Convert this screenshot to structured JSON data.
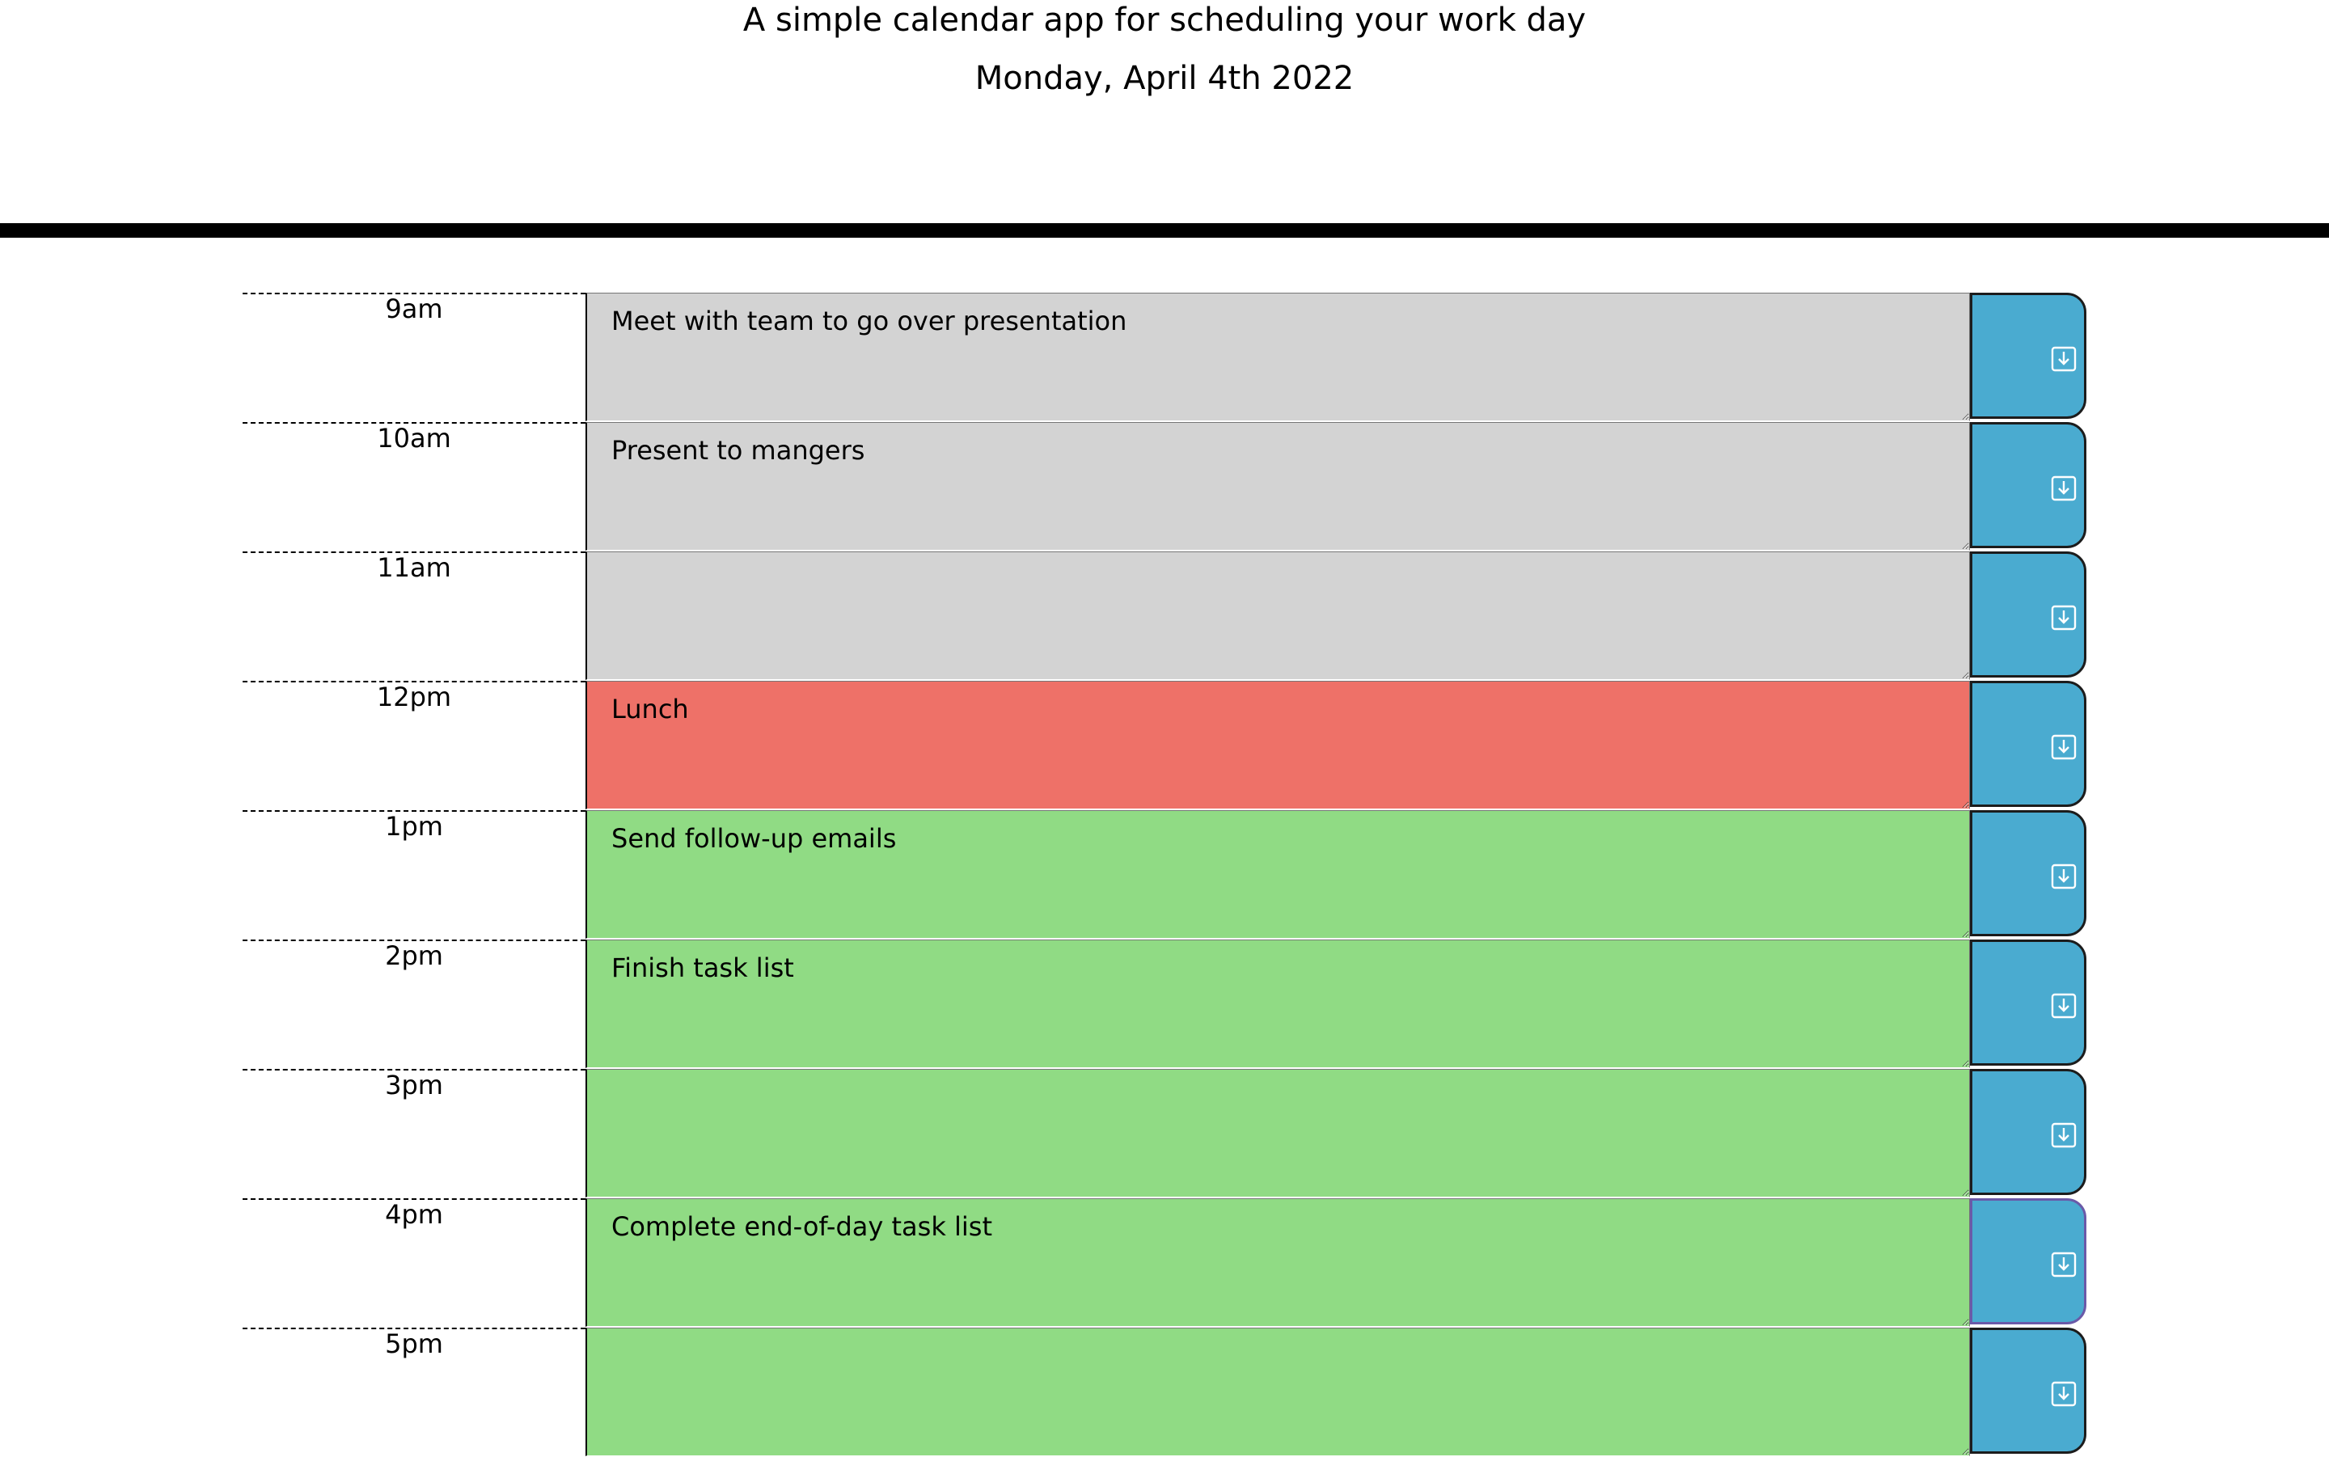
{
  "header": {
    "lead": "A simple calendar app for scheduling your work day",
    "current_day": "Monday, April 4th 2022"
  },
  "colors": {
    "past": "#d3d3d3",
    "present": "#ee7168",
    "future": "#90db84",
    "save_button": "#4aabd0"
  },
  "time_blocks": [
    {
      "hour": "9am",
      "text": "Meet with team to go over presentation",
      "state": "past",
      "icon": "save-icon"
    },
    {
      "hour": "10am",
      "text": "Present to mangers",
      "state": "past",
      "icon": "save-icon"
    },
    {
      "hour": "11am",
      "text": "",
      "state": "past",
      "icon": "save-icon"
    },
    {
      "hour": "12pm",
      "text": "Lunch",
      "state": "present",
      "icon": "save-icon"
    },
    {
      "hour": "1pm",
      "text": "Send follow-up emails",
      "state": "future",
      "icon": "save-icon"
    },
    {
      "hour": "2pm",
      "text": "Finish task list",
      "state": "future",
      "icon": "save-icon"
    },
    {
      "hour": "3pm",
      "text": "",
      "state": "future",
      "icon": "save-icon"
    },
    {
      "hour": "4pm",
      "text": "Complete end-of-day task list",
      "state": "future",
      "icon": "save-icon"
    },
    {
      "hour": "5pm",
      "text": "",
      "state": "future",
      "icon": "save-icon"
    }
  ]
}
